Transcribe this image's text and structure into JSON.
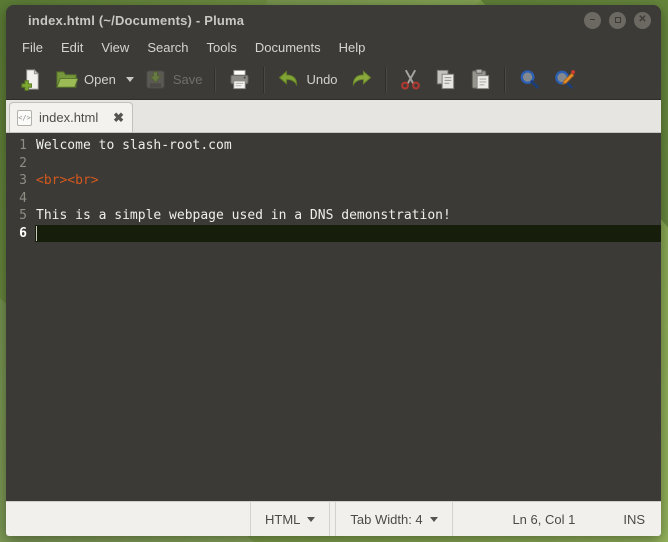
{
  "window": {
    "title": "index.html (~/Documents) - Pluma",
    "controls": {
      "minimize": "–",
      "close": "✕"
    }
  },
  "menu": {
    "items": [
      "File",
      "Edit",
      "View",
      "Search",
      "Tools",
      "Documents",
      "Help"
    ]
  },
  "toolbar": {
    "open_label": "Open",
    "save_label": "Save",
    "undo_label": "Undo",
    "icons": [
      "new-document",
      "open-folder",
      "dropdown",
      "save",
      "print",
      "undo",
      "redo",
      "cut",
      "copy",
      "paste",
      "find",
      "find-replace"
    ]
  },
  "tab": {
    "icon_glyph": "</>",
    "title": "index.html",
    "close_glyph": "✖"
  },
  "editor": {
    "lines": [
      {
        "num": "1",
        "text": "Welcome to slash-root.com"
      },
      {
        "num": "2",
        "text": ""
      },
      {
        "num": "3",
        "text": "<br><br>"
      },
      {
        "num": "4",
        "text": ""
      },
      {
        "num": "5",
        "text": "This is a simple webpage used in a DNS demonstration!"
      },
      {
        "num": "6",
        "text": ""
      }
    ],
    "colors": {
      "background": "#3b3a36",
      "text": "#eeeeec",
      "tag": "#d4591d",
      "line_numbers": "#8f8e85",
      "current_line_bg": "#161d0a"
    }
  },
  "statusbar": {
    "language": "HTML",
    "tab_width": "Tab Width: 4",
    "position": "Ln 6, Col 1",
    "mode": "INS"
  },
  "theme": {
    "desktop_green": "#7fa04b",
    "chrome_dark": "#3c3b37",
    "chrome_light": "#f1f0ed",
    "accent_green": "#7fa334"
  }
}
